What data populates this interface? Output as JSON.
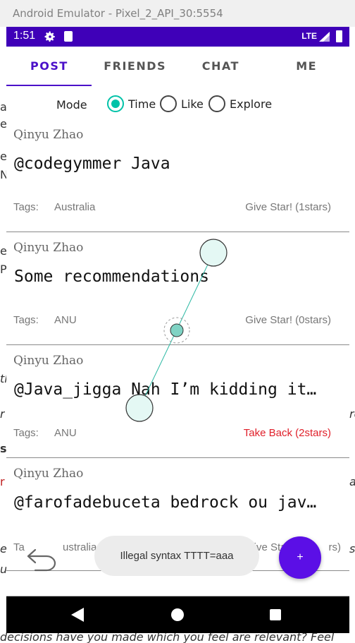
{
  "window": {
    "title": "Android Emulator - Pixel_2_API_30:5554"
  },
  "statusbar": {
    "time": "1:51",
    "network": "LTE",
    "icons": [
      "gear-icon",
      "sd-card-icon",
      "signal-icon",
      "battery-icon"
    ]
  },
  "tabs": [
    {
      "label": "POST",
      "active": true
    },
    {
      "label": "FRIENDS",
      "active": false
    },
    {
      "label": "CHAT",
      "active": false
    },
    {
      "label": "ME",
      "active": false
    }
  ],
  "mode": {
    "label": "Mode",
    "options": [
      {
        "label": "Time",
        "selected": true
      },
      {
        "label": "Like",
        "selected": false
      },
      {
        "label": "Explore",
        "selected": false
      }
    ]
  },
  "posts": [
    {
      "author": "Qinyu Zhao",
      "content": "@codegymmer Java",
      "tags_label": "Tags:",
      "tags": "Australia",
      "star": "Give Star! (1stars)"
    },
    {
      "author": "Qinyu Zhao",
      "content": "Some recommendations",
      "tags_label": "Tags:",
      "tags": "ANU",
      "star": "Give Star! (0stars)"
    },
    {
      "author": "Qinyu Zhao",
      "content": "@Java_jigga Nah I’m kidding it…",
      "tags_label": "Tags:",
      "tags": "ANU",
      "star": "Take Back (2stars)"
    },
    {
      "author": "Qinyu Zhao",
      "content": "@farofadebuceta bedrock ou jav…",
      "tags_label": "Ta",
      "tags": "ustralia",
      "star": "Give Sta",
      "star_tail": "rs)"
    }
  ],
  "toast": {
    "message": "Illegal syntax TTTT=aaa"
  },
  "fab": {
    "label": "+"
  },
  "bleed": {
    "left": [
      "a",
      "e",
      "e",
      "N",
      "e",
      "P",
      "th",
      "r",
      "s",
      "r",
      "e",
      "u"
    ],
    "right": [
      "re",
      "a",
      "s"
    ],
    "bottom": "decisions have you made which you feel are relevant? Feel"
  },
  "colors": {
    "accent": "#4b10c9",
    "statusbar": "#3f00b8",
    "radio": "#00c2a8",
    "fab": "#5b0fe6",
    "take_back": "#e0202a",
    "gesture": "#00b8a0"
  }
}
